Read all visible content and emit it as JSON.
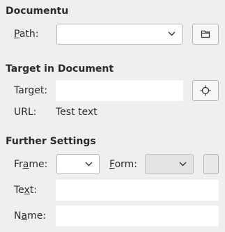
{
  "document_section": {
    "heading": "Documentu",
    "path_label_pre": "",
    "path_label_mn": "P",
    "path_label_post": "ath:",
    "path_value": "",
    "open_icon": "folder-icon"
  },
  "target_section": {
    "heading": "Target in Document",
    "target_label_pre": "Tar",
    "target_label_mn": "g",
    "target_label_post": "et:",
    "target_value": "",
    "target_icon": "crosshair-icon",
    "url_label": "URL:",
    "url_value": "Test text"
  },
  "further_section": {
    "heading": "Further Settings",
    "frame_label_pre": "Fr",
    "frame_label_mn": "a",
    "frame_label_post": "me:",
    "frame_value": "",
    "form_label_pre": "",
    "form_label_mn": "F",
    "form_label_post": "orm:",
    "form_value": "",
    "text_label_pre": "Te",
    "text_label_mn": "x",
    "text_label_post": "t:",
    "text_value": "",
    "name_label_pre": "N",
    "name_label_mn": "a",
    "name_label_post": "me:",
    "name_value": ""
  }
}
